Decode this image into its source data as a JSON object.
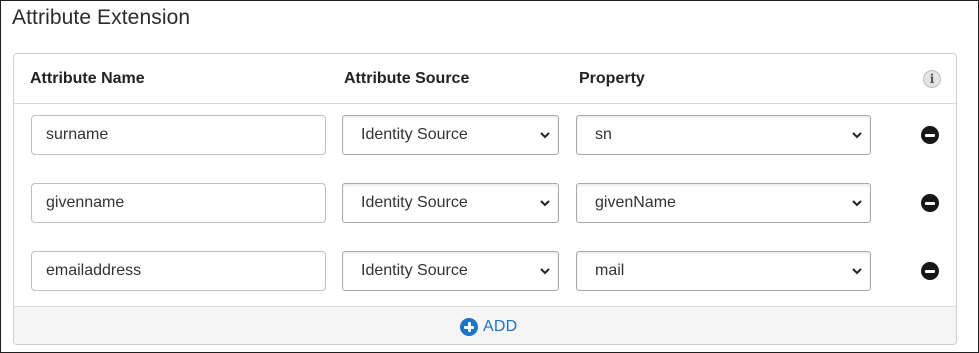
{
  "title": "Attribute Extension",
  "columns": {
    "name": "Attribute Name",
    "source": "Attribute Source",
    "property": "Property"
  },
  "info_icon": {
    "glyph": "i",
    "icon": "info-icon"
  },
  "rows": [
    {
      "name": "surname",
      "source": "Identity Source",
      "property": "sn"
    },
    {
      "name": "givenname",
      "source": "Identity Source",
      "property": "givenName"
    },
    {
      "name": "emailaddress",
      "source": "Identity Source",
      "property": "mail"
    }
  ],
  "add_button": {
    "label": "ADD",
    "icon": "plus-circle-icon"
  },
  "remove_icon": "minus-circle-icon",
  "colors": {
    "accent": "#1f74c7",
    "border": "#cfcfcf",
    "footer_bg": "#f5f5f5"
  }
}
